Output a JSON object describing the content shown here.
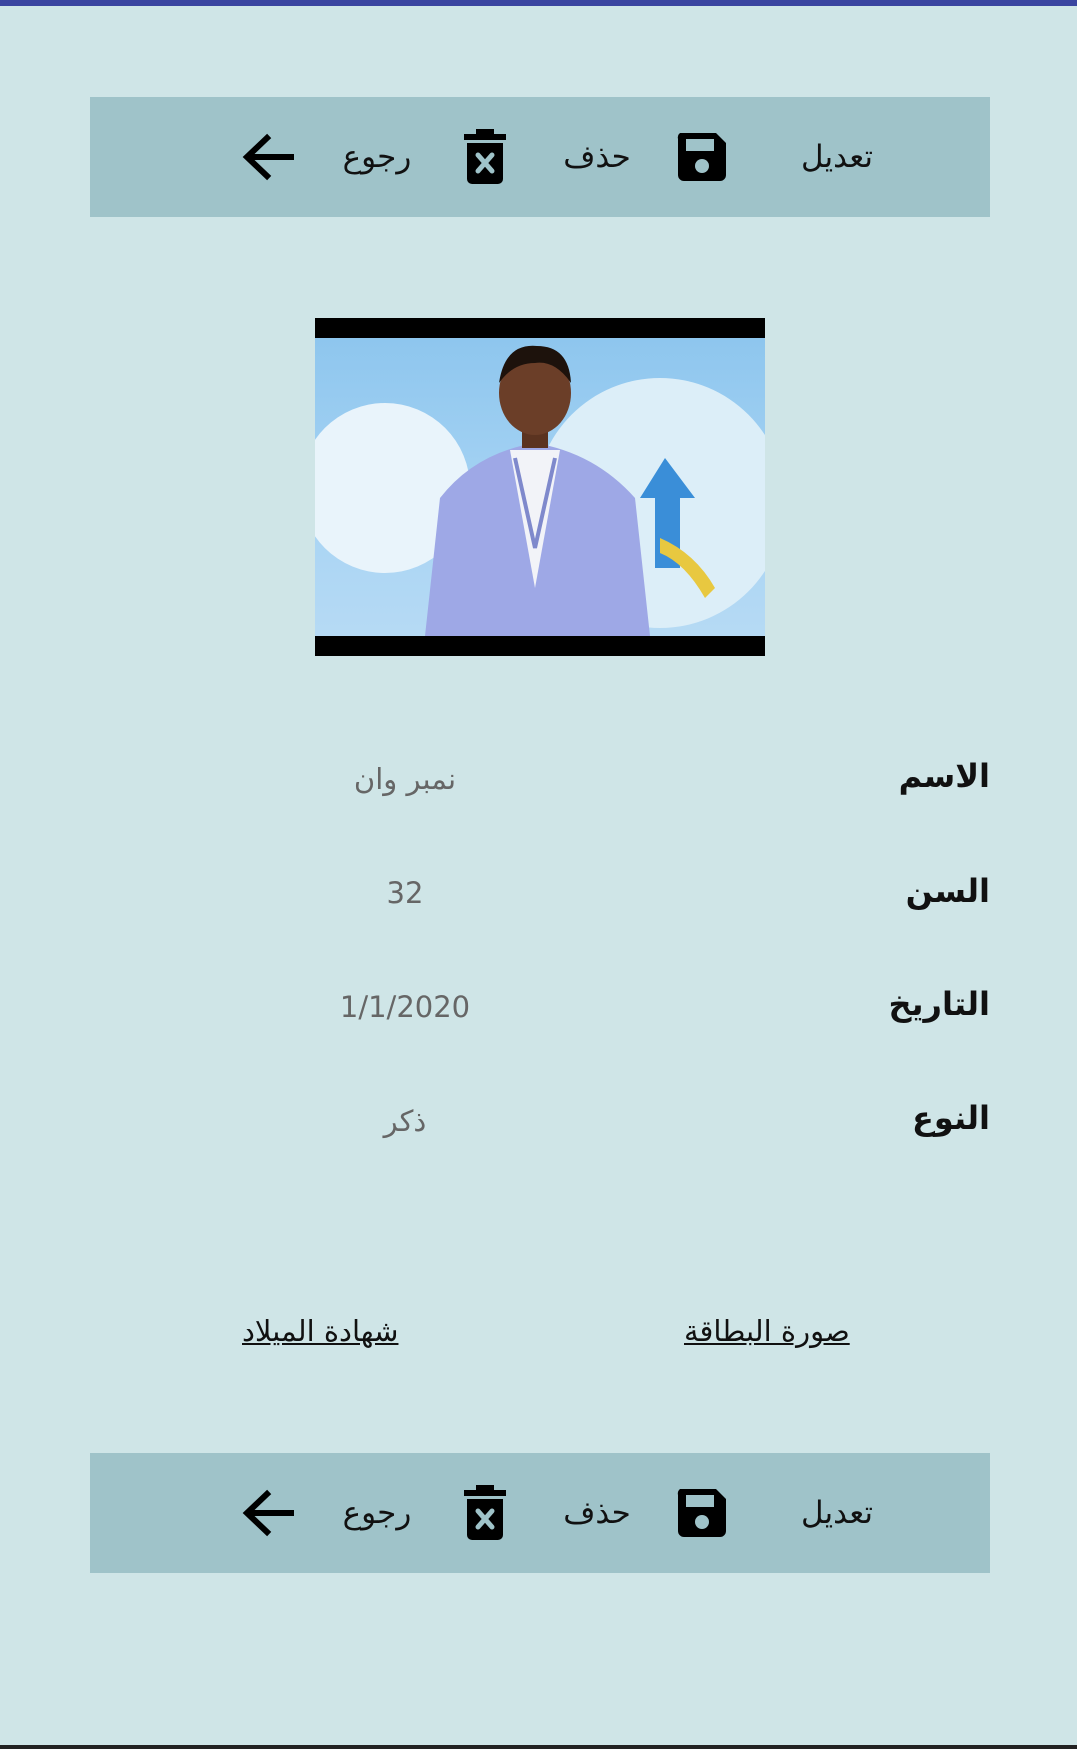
{
  "toolbar_top": {
    "edit_label": "تعديل",
    "delete_label": "حذف",
    "back_label": "رجوع"
  },
  "toolbar_bottom": {
    "edit_label": "تعديل",
    "delete_label": "حذف",
    "back_label": "رجوع"
  },
  "details": {
    "name_label": "الاسم",
    "name_value": "نمبر وان",
    "age_label": "السن",
    "age_value": "32",
    "date_label": "التاريخ",
    "date_value": "1/1/2020",
    "type_label": "النوع",
    "type_value": "ذكر"
  },
  "links": {
    "id_card": "صورة البطاقة",
    "birth_certificate": "شهادة الميلاد"
  },
  "colors": {
    "background": "#cfe5e7",
    "toolbar": "#9fc3c9",
    "top_strip": "#3a45a0"
  }
}
